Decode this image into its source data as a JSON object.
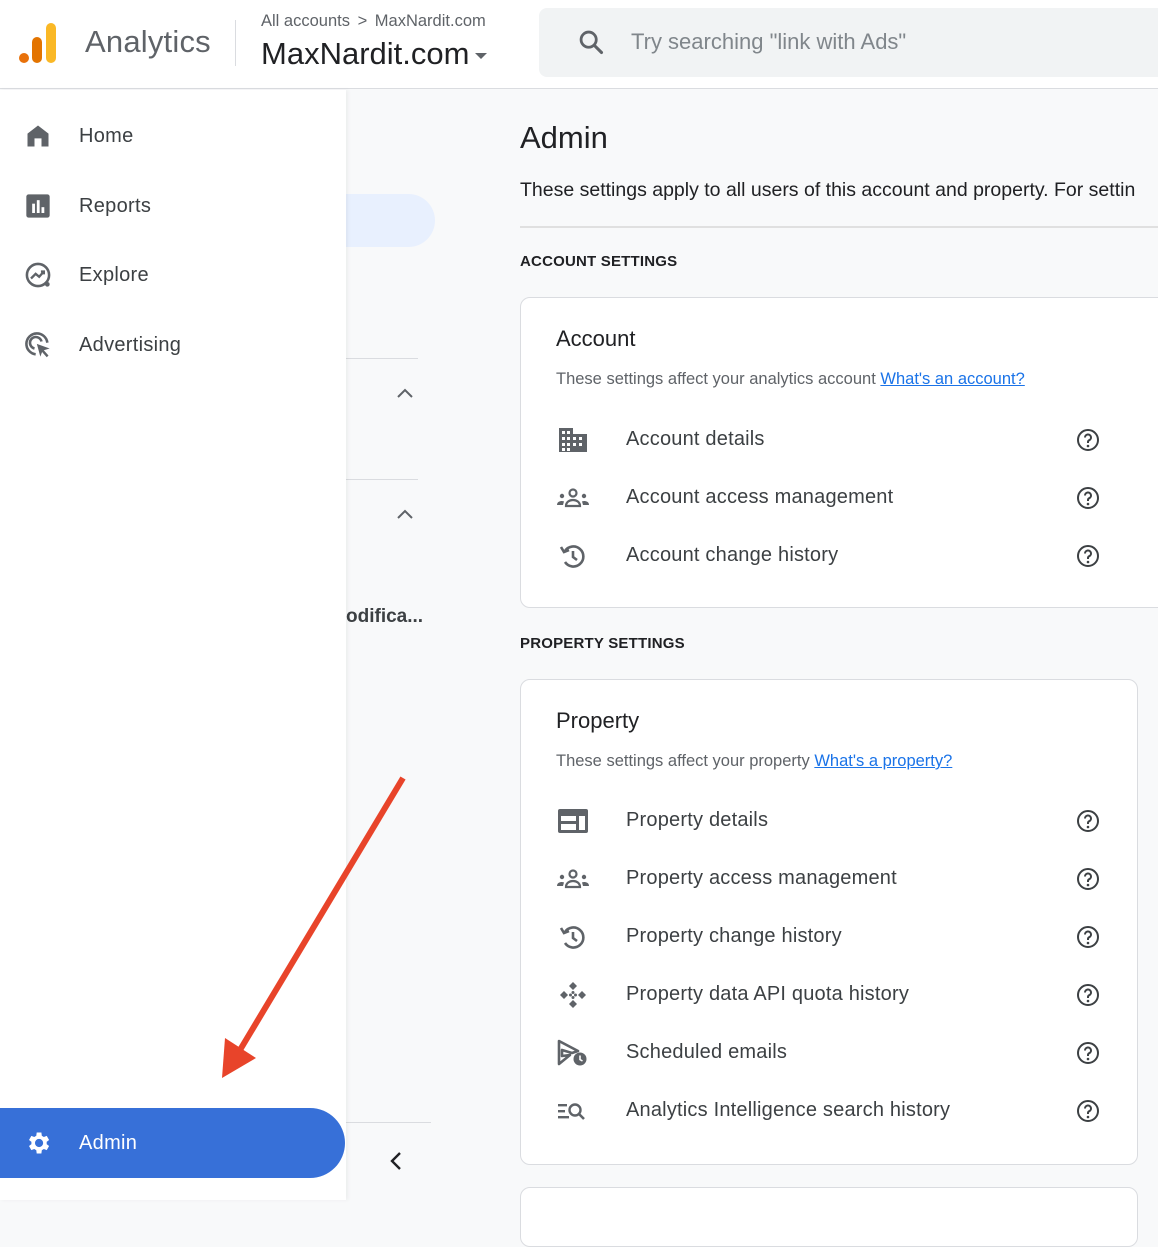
{
  "app": {
    "name": "Analytics",
    "breadcrumb": {
      "root": "All accounts",
      "separator": ">",
      "account": "MaxNardit.com"
    },
    "property_selector": "MaxNardit.com",
    "logo_colors": [
      "#e8710a",
      "#e37400",
      "#f9ab00"
    ]
  },
  "search": {
    "placeholder": "Try searching \"link with Ads\"",
    "value": ""
  },
  "nav": {
    "items": [
      {
        "label": "Home",
        "icon": "home-icon"
      },
      {
        "label": "Reports",
        "icon": "reports-icon"
      },
      {
        "label": "Explore",
        "icon": "explore-icon"
      },
      {
        "label": "Advertising",
        "icon": "advertising-icon"
      }
    ],
    "admin": {
      "label": "Admin",
      "icon": "gear-icon",
      "active": true,
      "color": "#3770d8"
    }
  },
  "underlying_panel": {
    "truncated_text": "odifica..."
  },
  "main": {
    "title": "Admin",
    "description": "These settings apply to all users of this account and property. For settin",
    "account_section": {
      "label": "ACCOUNT SETTINGS",
      "card": {
        "title": "Account",
        "description": "These settings affect your analytics account",
        "link": "What's an account?",
        "rows": [
          {
            "label": "Account details",
            "icon": "building-icon"
          },
          {
            "label": "Account access management",
            "icon": "people-icon"
          },
          {
            "label": "Account change history",
            "icon": "history-icon"
          }
        ]
      }
    },
    "property_section": {
      "label": "PROPERTY SETTINGS",
      "card": {
        "title": "Property",
        "description": "These settings affect your property",
        "link": "What's a property?",
        "rows": [
          {
            "label": "Property details",
            "icon": "web-panel-icon"
          },
          {
            "label": "Property access management",
            "icon": "people-icon"
          },
          {
            "label": "Property change history",
            "icon": "history-icon"
          },
          {
            "label": "Property data API quota history",
            "icon": "api-quota-icon"
          },
          {
            "label": "Scheduled emails",
            "icon": "scheduled-send-icon"
          },
          {
            "label": "Analytics Intelligence search history",
            "icon": "search-history-icon"
          }
        ]
      }
    }
  },
  "annotation": {
    "type": "arrow",
    "color": "#e8442a",
    "points_to": "Admin"
  }
}
